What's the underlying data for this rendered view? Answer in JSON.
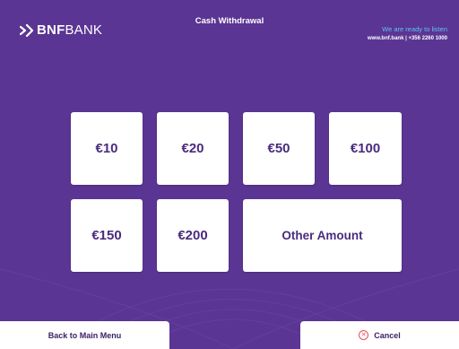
{
  "brand": {
    "name_bold": "BNF",
    "name_light": "BANK",
    "logo_icon": "chevron-arrow-icon"
  },
  "header": {
    "title": "Cash Withdrawal",
    "tagline": "We are ready to listen",
    "contact": "www.bnf.bank | +356 2260 1000"
  },
  "amounts": [
    {
      "label": "€10"
    },
    {
      "label": "€20"
    },
    {
      "label": "€50"
    },
    {
      "label": "€100"
    },
    {
      "label": "€150"
    },
    {
      "label": "€200"
    },
    {
      "label": "Other Amount"
    }
  ],
  "footer": {
    "back_label": "Back to Main Menu",
    "cancel_label": "Cancel",
    "cancel_icon": "cancel-circle-icon"
  },
  "colors": {
    "background": "#5b3593",
    "button_text": "#4a2b7e",
    "accent_blue": "#5ec3ef",
    "cancel_red": "#e8505b"
  }
}
